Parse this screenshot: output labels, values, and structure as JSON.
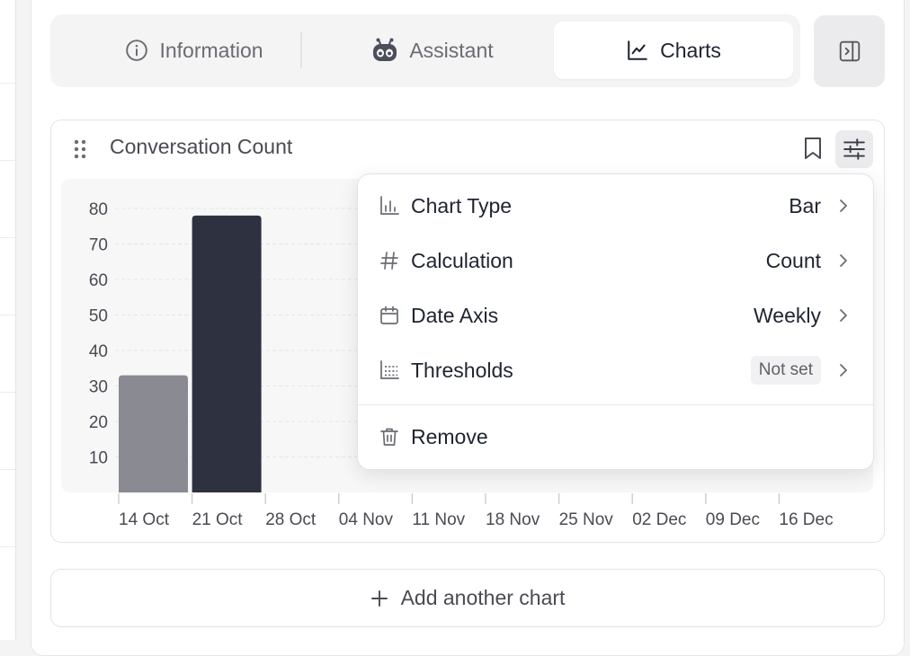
{
  "tabs": [
    {
      "label": "Information",
      "icon": "info-icon"
    },
    {
      "label": "Assistant",
      "icon": "robot-icon"
    },
    {
      "label": "Charts",
      "icon": "line-chart-icon",
      "active": true
    }
  ],
  "card": {
    "title": "Conversation Count"
  },
  "menu": {
    "items": [
      {
        "label": "Chart Type",
        "value": "Bar",
        "icon": "bar-chart-icon"
      },
      {
        "label": "Calculation",
        "value": "Count",
        "icon": "hash-icon"
      },
      {
        "label": "Date Axis",
        "value": "Weekly",
        "icon": "calendar-icon"
      },
      {
        "label": "Thresholds",
        "value": "Not set",
        "icon": "thresholds-icon"
      }
    ],
    "remove_label": "Remove"
  },
  "add_chart_label": "Add another chart",
  "colors": {
    "bar_primary": "#2e3240",
    "bar_secondary": "#8a8a93"
  },
  "chart_data": {
    "type": "bar",
    "categories": [
      "14 Oct",
      "21 Oct",
      "28 Oct",
      "04 Nov",
      "11 Nov",
      "18 Nov",
      "25 Nov",
      "02 Dec",
      "09 Dec",
      "16 Dec"
    ],
    "values": [
      33,
      78,
      null,
      null,
      null,
      null,
      null,
      null,
      null,
      null
    ],
    "y_ticks": [
      10,
      20,
      30,
      40,
      50,
      60,
      70,
      80
    ],
    "ylim": [
      0,
      80
    ],
    "grid": true,
    "title": "Conversation Count"
  }
}
